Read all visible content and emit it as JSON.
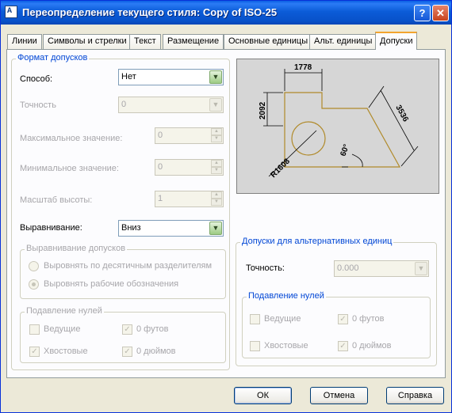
{
  "window": {
    "title": "Переопределение текущего стиля: Copy of ISO-25",
    "help_glyph": "?",
    "close_glyph": "✕",
    "icon_label": "A"
  },
  "tabs": [
    {
      "label": "Линии"
    },
    {
      "label": "Символы и стрелки"
    },
    {
      "label": "Текст"
    },
    {
      "label": "Размещение"
    },
    {
      "label": "Основные единицы"
    },
    {
      "label": "Альт. единицы"
    },
    {
      "label": "Допуски"
    }
  ],
  "format": {
    "legend": "Формат допусков",
    "method_label": "Способ:",
    "method_value": "Нет",
    "precision_label": "Точность",
    "precision_value": "0",
    "upper_label": "Максимальное значение:",
    "upper_value": "0",
    "lower_label": "Минимальное значение:",
    "lower_value": "0",
    "height_label": "Масштаб высоты:",
    "height_value": "1",
    "vpos_label": "Выравнивание:",
    "vpos_value": "Вниз"
  },
  "alignment": {
    "legend": "Выравнивание допусков",
    "opt1": "Выровнять по десятичным разделителям",
    "opt2": "Выровнять рабочие обозначения"
  },
  "zero_left": {
    "legend": "Подавление нулей",
    "leading": "Ведущие",
    "trailing": "Хвостовые",
    "feet": "0 футов",
    "inches": "0 дюймов"
  },
  "alt": {
    "legend": "Допуски для альтернативных единиц",
    "precision_label": "Точность:",
    "precision_value": "0.000"
  },
  "zero_right": {
    "legend": "Подавление нулей",
    "leading": "Ведущие",
    "trailing": "Хвостовые",
    "feet": "0 футов",
    "inches": "0 дюймов"
  },
  "preview": {
    "dim_top": "1778",
    "dim_left": "2092",
    "dim_diag": "3536",
    "dim_radius": "R1608",
    "dim_angle": "60°",
    "dim_color": "#000000",
    "shape_color": "#B08A2A"
  },
  "buttons": {
    "ok": "ОК",
    "cancel": "Отмена",
    "help": "Справка"
  }
}
